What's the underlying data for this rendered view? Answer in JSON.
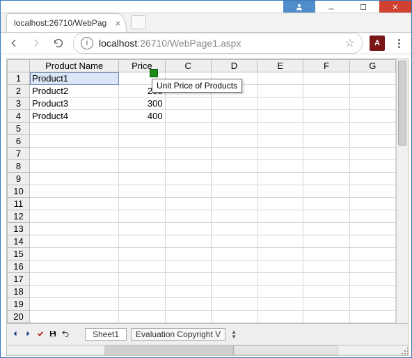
{
  "browser": {
    "tab_title": "localhost:26710/WebPag",
    "url_host": "localhost",
    "url_rest": ":26710/WebPage1.aspx"
  },
  "spreadsheet": {
    "col_headers": [
      "Product Name",
      "Price",
      "C",
      "D",
      "E",
      "F",
      "G"
    ],
    "rows": [
      {
        "n": "1",
        "a": "Product1",
        "b": ""
      },
      {
        "n": "2",
        "a": "Product2",
        "b": "200"
      },
      {
        "n": "3",
        "a": "Product3",
        "b": "300"
      },
      {
        "n": "4",
        "a": "Product4",
        "b": "400"
      },
      {
        "n": "5"
      },
      {
        "n": "6"
      },
      {
        "n": "7"
      },
      {
        "n": "8"
      },
      {
        "n": "9"
      },
      {
        "n": "10"
      },
      {
        "n": "11"
      },
      {
        "n": "12"
      },
      {
        "n": "13"
      },
      {
        "n": "14"
      },
      {
        "n": "15"
      },
      {
        "n": "16"
      },
      {
        "n": "17"
      },
      {
        "n": "18"
      },
      {
        "n": "19"
      },
      {
        "n": "20"
      }
    ],
    "comment_tooltip": "Unit Price of Products",
    "sheet_tab": "Sheet1",
    "eval_text": "Evaluation Copyright V"
  },
  "chart_data": {
    "type": "table",
    "columns": [
      "Product Name",
      "Price"
    ],
    "rows": [
      [
        "Product1",
        null
      ],
      [
        "Product2",
        200
      ],
      [
        "Product3",
        300
      ],
      [
        "Product4",
        400
      ]
    ],
    "notes": {
      "Price_header_comment": "Unit Price of Products"
    }
  }
}
